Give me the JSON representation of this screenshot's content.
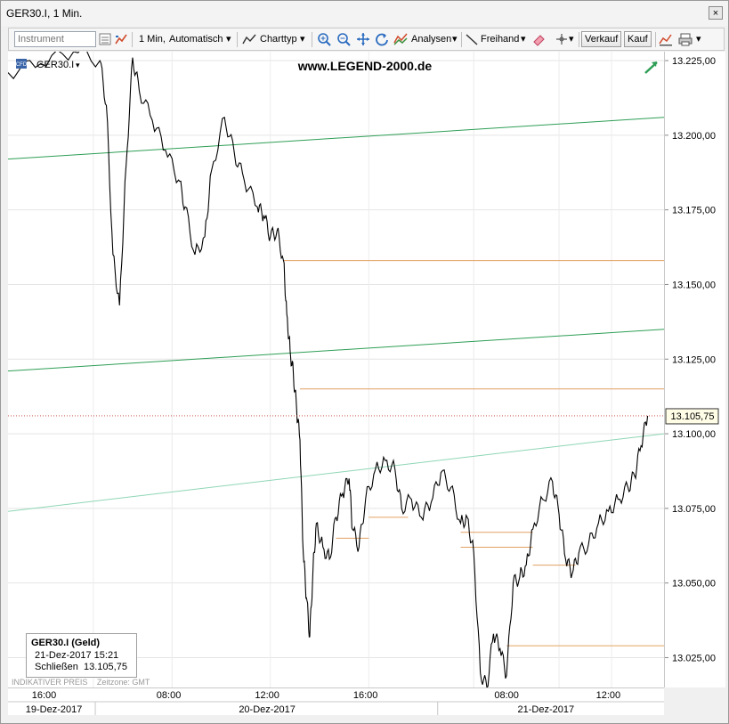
{
  "window": {
    "title": "GER30.I, 1 Min.",
    "close": "×"
  },
  "toolbar": {
    "instrument_placeholder": "Instrument",
    "interval": "1 Min,",
    "mode": "Automatisch",
    "charttyp": "Charttyp",
    "analysen": "Analysen",
    "freihand": "Freihand",
    "verkauf": "Verkauf",
    "kauf": "Kauf"
  },
  "chart": {
    "symbol": "GER30.I",
    "watermark": "www.LEGEND-2000.de",
    "current_price_label": "13.105,75",
    "info": {
      "title": "GER30.I (Geld)",
      "datetime": "21-Dez-2017 15:21",
      "close_label": "Schließen",
      "close_value": "13.105,75"
    },
    "indikativ": "INDIKATIVER PREIS",
    "zeitzone": "Zeitzone: GMT",
    "colors": {
      "price": "#000000",
      "trend": "#2e9e55",
      "trend_light": "#8fd6b6",
      "support": "#e3a063",
      "current": "#c0392b"
    }
  },
  "chart_data": {
    "type": "line",
    "y_ticks": [
      "13.225,00",
      "13.200,00",
      "13.175,00",
      "13.150,00",
      "13.125,00",
      "13.100,00",
      "13.075,00",
      "13.050,00",
      "13.025,00"
    ],
    "ylim": [
      13015,
      13228
    ],
    "x_time_ticks": [
      "16:00",
      "08:00",
      "12:00",
      "16:00",
      "08:00",
      "12:00"
    ],
    "x_date_labels": [
      "19-Dez-2017",
      "20-Dez-2017",
      "21-Dez-2017"
    ],
    "series": [
      {
        "points": [
          [
            0.0,
            13221
          ],
          [
            0.05,
            13224
          ],
          [
            0.1,
            13228
          ],
          [
            0.14,
            13225
          ],
          [
            0.15,
            13210
          ],
          [
            0.16,
            13160
          ],
          [
            0.17,
            13143
          ],
          [
            0.18,
            13190
          ],
          [
            0.19,
            13226
          ],
          [
            0.2,
            13215
          ],
          [
            0.22,
            13205
          ],
          [
            0.24,
            13195
          ],
          [
            0.26,
            13185
          ],
          [
            0.27,
            13176
          ],
          [
            0.285,
            13160
          ],
          [
            0.3,
            13166
          ],
          [
            0.31,
            13188
          ],
          [
            0.33,
            13206
          ],
          [
            0.345,
            13194
          ],
          [
            0.36,
            13185
          ],
          [
            0.38,
            13176
          ],
          [
            0.39,
            13173
          ],
          [
            0.4,
            13166
          ],
          [
            0.41,
            13168
          ],
          [
            0.42,
            13158
          ],
          [
            0.425,
            13140
          ],
          [
            0.43,
            13128
          ],
          [
            0.435,
            13120
          ],
          [
            0.44,
            13108
          ],
          [
            0.445,
            13098
          ],
          [
            0.45,
            13060
          ],
          [
            0.455,
            13045
          ],
          [
            0.46,
            13032
          ],
          [
            0.465,
            13055
          ],
          [
            0.47,
            13070
          ],
          [
            0.48,
            13062
          ],
          [
            0.49,
            13058
          ],
          [
            0.5,
            13072
          ],
          [
            0.51,
            13080
          ],
          [
            0.52,
            13085
          ],
          [
            0.525,
            13068
          ],
          [
            0.535,
            13062
          ],
          [
            0.545,
            13078
          ],
          [
            0.56,
            13088
          ],
          [
            0.575,
            13091
          ],
          [
            0.59,
            13088
          ],
          [
            0.6,
            13075
          ],
          [
            0.615,
            13078
          ],
          [
            0.63,
            13072
          ],
          [
            0.645,
            13077
          ],
          [
            0.66,
            13087
          ],
          [
            0.675,
            13082
          ],
          [
            0.69,
            13070
          ],
          [
            0.7,
            13072
          ],
          [
            0.71,
            13060
          ],
          [
            0.72,
            13020
          ],
          [
            0.73,
            13015
          ],
          [
            0.74,
            13033
          ],
          [
            0.75,
            13028
          ],
          [
            0.76,
            13019
          ],
          [
            0.77,
            13050
          ],
          [
            0.78,
            13052
          ],
          [
            0.79,
            13056
          ],
          [
            0.8,
            13068
          ],
          [
            0.815,
            13078
          ],
          [
            0.83,
            13084
          ],
          [
            0.84,
            13073
          ],
          [
            0.85,
            13058
          ],
          [
            0.86,
            13053
          ],
          [
            0.87,
            13060
          ],
          [
            0.885,
            13063
          ],
          [
            0.9,
            13070
          ],
          [
            0.915,
            13074
          ],
          [
            0.93,
            13078
          ],
          [
            0.945,
            13082
          ],
          [
            0.955,
            13086
          ],
          [
            0.965,
            13096
          ],
          [
            0.975,
            13106
          ]
        ]
      }
    ],
    "trend_lines": [
      {
        "from": [
          0.0,
          13192
        ],
        "to": [
          1.0,
          13206
        ]
      },
      {
        "from": [
          0.0,
          13121
        ],
        "to": [
          1.0,
          13135
        ]
      },
      {
        "from": [
          0.0,
          13074
        ],
        "to": [
          1.0,
          13100
        ]
      }
    ],
    "support_lines": [
      {
        "from": 0.42,
        "to": 1.0,
        "y": 13158
      },
      {
        "from": 0.445,
        "to": 1.0,
        "y": 13115
      },
      {
        "from": 0.5,
        "to": 0.55,
        "y": 13065
      },
      {
        "from": 0.55,
        "to": 0.61,
        "y": 13072
      },
      {
        "from": 0.69,
        "to": 0.8,
        "y": 13067
      },
      {
        "from": 0.69,
        "to": 0.8,
        "y": 13062
      },
      {
        "from": 0.8,
        "to": 0.865,
        "y": 13056
      },
      {
        "from": 0.76,
        "to": 1.0,
        "y": 13029
      }
    ],
    "current_price": 13106
  }
}
